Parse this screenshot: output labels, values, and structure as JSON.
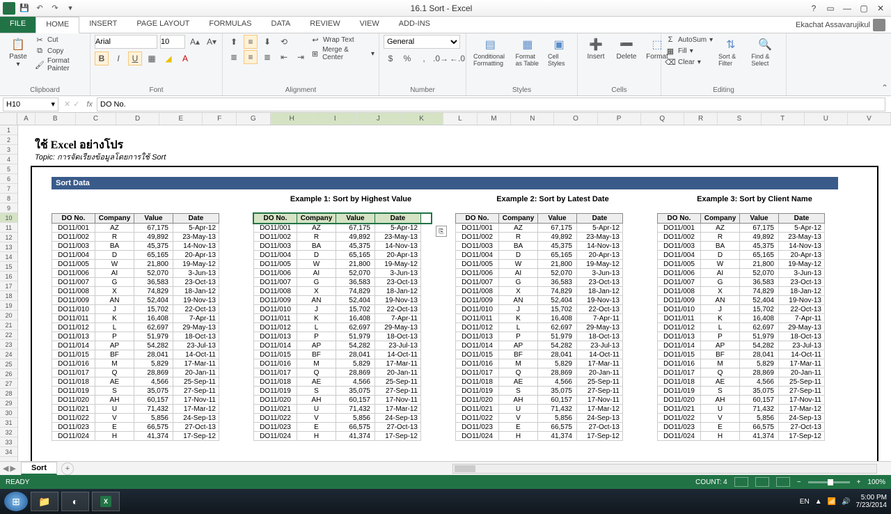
{
  "titlebar": {
    "title": "16.1 Sort - Excel"
  },
  "ribbon_tabs": {
    "file": "FILE",
    "tabs": [
      "HOME",
      "INSERT",
      "PAGE LAYOUT",
      "FORMULAS",
      "DATA",
      "REVIEW",
      "VIEW",
      "ADD-INS"
    ],
    "user": "Ekachat Assavarujikul"
  },
  "ribbon": {
    "clipboard": {
      "paste": "Paste",
      "cut": "Cut",
      "copy": "Copy",
      "painter": "Format Painter",
      "label": "Clipboard"
    },
    "font": {
      "name": "Arial",
      "size": "10",
      "label": "Font"
    },
    "alignment": {
      "wrap": "Wrap Text",
      "merge": "Merge & Center",
      "label": "Alignment"
    },
    "number": {
      "format": "General",
      "label": "Number"
    },
    "styles": {
      "cond": "Conditional Formatting",
      "table": "Format as Table",
      "cell": "Cell Styles",
      "label": "Styles"
    },
    "cells": {
      "insert": "Insert",
      "delete": "Delete",
      "format": "Format",
      "label": "Cells"
    },
    "editing": {
      "autosum": "AutoSum",
      "fill": "Fill",
      "clear": "Clear",
      "sort": "Sort & Filter",
      "find": "Find & Select",
      "label": "Editing"
    }
  },
  "fbar": {
    "name": "H10",
    "formula": "DO No."
  },
  "columns": [
    "A",
    "B",
    "C",
    "D",
    "E",
    "F",
    "G",
    "H",
    "I",
    "J",
    "K",
    "L",
    "M",
    "N",
    "O",
    "P",
    "Q",
    "R",
    "S",
    "T",
    "U",
    "V"
  ],
  "content": {
    "title": "ใช้ Excel อย่างโปร",
    "subtitle": "Topic: การจัดเรียงข้อมูลโดยการใช้ Sort",
    "sortbar": "Sort Data",
    "ex1": "Example 1: Sort by Highest Value",
    "ex2": "Example 2: Sort by Latest Date",
    "ex3": "Example 3: Sort by Client Name",
    "headers": [
      "DO No.",
      "Company",
      "Value",
      "Date"
    ],
    "rows": [
      [
        "DO11/001",
        "AZ",
        "67,175",
        "5-Apr-12"
      ],
      [
        "DO11/002",
        "R",
        "49,892",
        "23-May-13"
      ],
      [
        "DO11/003",
        "BA",
        "45,375",
        "14-Nov-13"
      ],
      [
        "DO11/004",
        "D",
        "65,165",
        "20-Apr-13"
      ],
      [
        "DO11/005",
        "W",
        "21,800",
        "19-May-12"
      ],
      [
        "DO11/006",
        "AI",
        "52,070",
        "3-Jun-13"
      ],
      [
        "DO11/007",
        "G",
        "36,583",
        "23-Oct-13"
      ],
      [
        "DO11/008",
        "X",
        "74,829",
        "18-Jan-12"
      ],
      [
        "DO11/009",
        "AN",
        "52,404",
        "19-Nov-13"
      ],
      [
        "DO11/010",
        "J",
        "15,702",
        "22-Oct-13"
      ],
      [
        "DO11/011",
        "K",
        "16,408",
        "7-Apr-11"
      ],
      [
        "DO11/012",
        "L",
        "62,697",
        "29-May-13"
      ],
      [
        "DO11/013",
        "P",
        "51,979",
        "18-Oct-13"
      ],
      [
        "DO11/014",
        "AP",
        "54,282",
        "23-Jul-13"
      ],
      [
        "DO11/015",
        "BF",
        "28,041",
        "14-Oct-11"
      ],
      [
        "DO11/016",
        "M",
        "5,829",
        "17-Mar-11"
      ],
      [
        "DO11/017",
        "Q",
        "28,869",
        "20-Jan-11"
      ],
      [
        "DO11/018",
        "AE",
        "4,566",
        "25-Sep-11"
      ],
      [
        "DO11/019",
        "S",
        "35,075",
        "27-Sep-11"
      ],
      [
        "DO11/020",
        "AH",
        "60,157",
        "17-Nov-11"
      ],
      [
        "DO11/021",
        "U",
        "71,432",
        "17-Mar-12"
      ],
      [
        "DO11/022",
        "V",
        "5,856",
        "24-Sep-13"
      ],
      [
        "DO11/023",
        "E",
        "66,575",
        "27-Oct-13"
      ],
      [
        "DO11/024",
        "H",
        "41,374",
        "17-Sep-12"
      ]
    ]
  },
  "sheet": {
    "name": "Sort"
  },
  "status": {
    "ready": "READY",
    "count": "COUNT: 4",
    "zoom": "100%"
  },
  "taskbar": {
    "lang": "EN",
    "time": "5:00 PM",
    "date": "7/23/2014"
  }
}
